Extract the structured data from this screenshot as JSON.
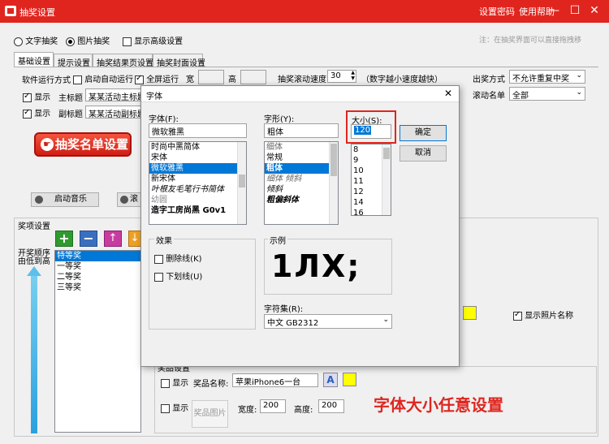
{
  "window": {
    "title": "抽奖设置",
    "link_password": "设置密码",
    "link_help": "使用帮助",
    "min": "—",
    "max": "☐",
    "close": "✕"
  },
  "mode": {
    "text_draw": "文字抽奖",
    "image_draw": "图片抽奖",
    "show_advanced": "显示高级设置",
    "hint": "注：在抽奖界面可以直接拖拽移"
  },
  "tabs": [
    "基础设置",
    "提示设置",
    "抽奖结果页设置",
    "抽奖封面设置"
  ],
  "basic": {
    "run_mode": "软件运行方式",
    "auto_run": "启动自动运行",
    "fullscreen": "全屏运行",
    "width": "宽",
    "height": "高",
    "scroll_speed": "抽奖滚动速度",
    "scroll_value": "30",
    "speed_hint": "（数字越小速度越快）",
    "award_mode": "出奖方式",
    "award_value": "不允许重复中奖",
    "scroll_list": "滚动名单",
    "scroll_list_value": "全部",
    "show": "显示",
    "main_title": "主标题",
    "main_title_value": "某某活动主标题",
    "sub_title": "副标题",
    "sub_title_value": "某某活动副标题",
    "draw_button": "抽奖名单设置",
    "start_music": "启动音乐",
    "music2": "滚",
    "show_photo_name": "显示照片名称"
  },
  "prizes": {
    "title": "奖项设置",
    "side_text": "开奖顺序由低到高",
    "items": [
      "特等奖",
      "一等奖",
      "二等奖",
      "三等奖"
    ],
    "prize_settings": "奖品设置",
    "show": "显示",
    "prize_name": "奖品名称:",
    "prize_value": "苹果iPhone6一台",
    "show2": "显示",
    "prize_image": "奖品图片",
    "width": "宽度:",
    "width_value": "200",
    "height": "高度:",
    "height_value": "200"
  },
  "font_dialog": {
    "title": "字体",
    "close": "✕",
    "font_label": "字体(F):",
    "font_value": "微软雅黑",
    "fonts": [
      "时尚中黑简体",
      "宋体",
      "微软雅黑",
      "新宋体",
      "叶根友毛笔行书简体",
      "幼圆",
      "造字工房尚黑 G0v1"
    ],
    "style_label": "字形(Y):",
    "style_value": "粗体",
    "styles": [
      "细体",
      "常规",
      "粗体",
      "细体 倾斜",
      "倾斜",
      "粗偏斜体"
    ],
    "size_label": "大小(S):",
    "size_value": "120",
    "sizes": [
      "8",
      "9",
      "10",
      "11",
      "12",
      "14",
      "16"
    ],
    "ok": "确定",
    "cancel": "取消",
    "effects": "效果",
    "strike": "删除线(K)",
    "underline": "下划线(U)",
    "sample": "示例",
    "sample_text": "1ЛX;",
    "charset_label": "字符集(R):",
    "charset_value": "中文 GB2312"
  },
  "annotation": {
    "text": "字体大小任意设置"
  },
  "colors": {
    "title_red": "#e0251f",
    "selection_blue": "#0078d7",
    "swatch_yellow": "#ffff00"
  }
}
